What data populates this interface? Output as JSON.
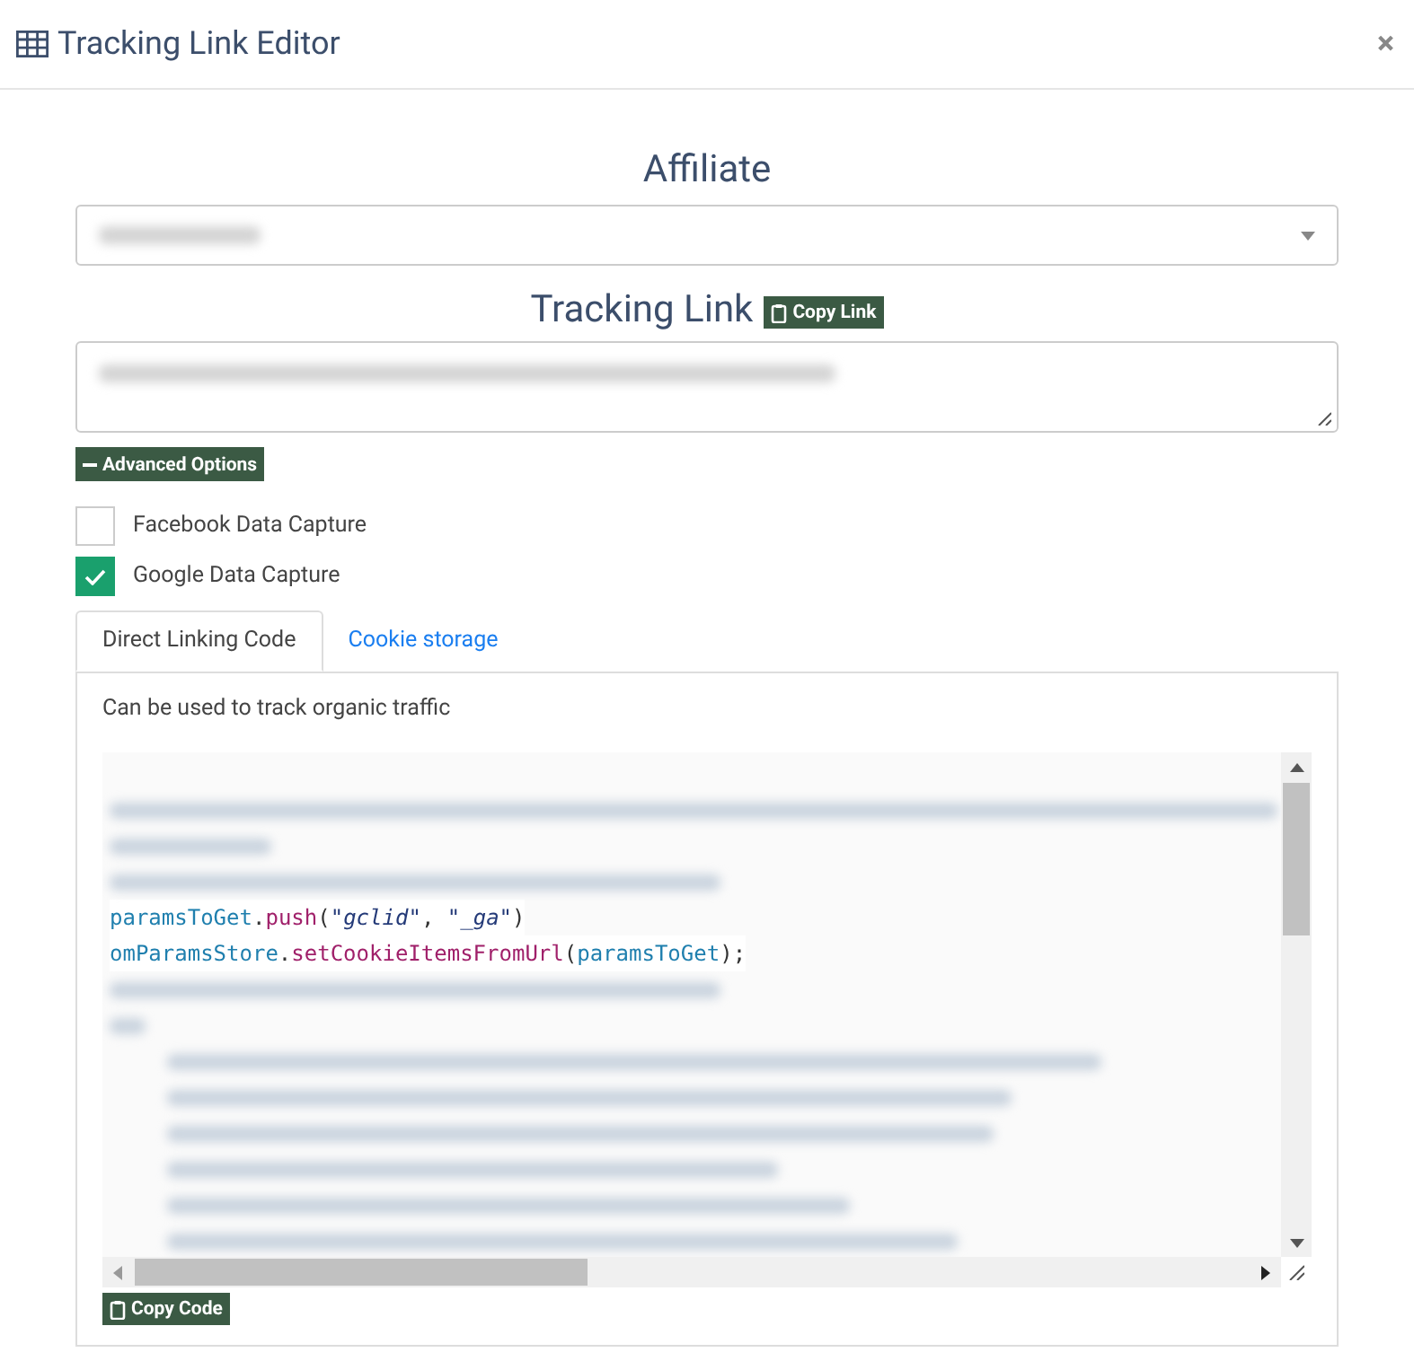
{
  "window": {
    "title": "Tracking Link Editor",
    "close": "×"
  },
  "affiliate": {
    "label": "Affiliate"
  },
  "tracking_link": {
    "label": "Tracking Link",
    "copy_button": "Copy Link"
  },
  "advanced_options_button": "Advanced Options",
  "checkboxes": [
    {
      "label": "Facebook Data Capture",
      "checked": false
    },
    {
      "label": "Google Data Capture",
      "checked": true
    }
  ],
  "tabs": [
    {
      "label": "Direct Linking Code",
      "selected": true
    },
    {
      "label": "Cookie storage",
      "selected": false
    }
  ],
  "panel": {
    "description": "Can be used to track organic traffic",
    "code_lines": [
      {
        "kind": "redacted"
      },
      {
        "kind": "redacted"
      },
      {
        "kind": "redacted"
      },
      {
        "kind": "code",
        "tokens": [
          {
            "kind": "ident",
            "text": "paramsToGet"
          },
          {
            "kind": "punct",
            "text": "."
          },
          {
            "kind": "method",
            "text": "push"
          },
          {
            "kind": "punct",
            "text": "("
          },
          {
            "kind": "string",
            "text": "\"gclid\""
          },
          {
            "kind": "punct",
            "text": ", "
          },
          {
            "kind": "string",
            "text": "\"_ga\""
          },
          {
            "kind": "punct",
            "text": ")"
          }
        ]
      },
      {
        "kind": "code",
        "tokens": [
          {
            "kind": "ident",
            "text": "omParamsStore"
          },
          {
            "kind": "punct",
            "text": "."
          },
          {
            "kind": "method",
            "text": "setCookieItemsFromUrl"
          },
          {
            "kind": "punct",
            "text": "("
          },
          {
            "kind": "ident",
            "text": "paramsToGet"
          },
          {
            "kind": "punct",
            "text": ");"
          }
        ]
      },
      {
        "kind": "redacted"
      },
      {
        "kind": "redacted"
      },
      {
        "kind": "redacted"
      },
      {
        "kind": "redacted"
      },
      {
        "kind": "redacted"
      },
      {
        "kind": "redacted"
      },
      {
        "kind": "redacted"
      },
      {
        "kind": "redacted"
      }
    ],
    "copy_button": "Copy Code"
  }
}
